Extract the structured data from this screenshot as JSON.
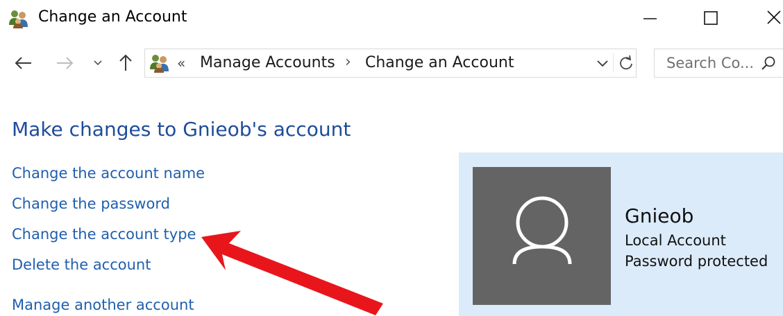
{
  "window": {
    "title": "Change an Account",
    "icon": "users-control-panel-icon",
    "controls": [
      "minimize-icon",
      "maximize-icon",
      "close-icon"
    ]
  },
  "navigation": {
    "back": "back-arrow-icon",
    "forward": "forward-arrow-icon",
    "recent": "chevron-down-icon",
    "up": "up-arrow-icon"
  },
  "address_bar": {
    "overflow": "«",
    "breadcrumbs": [
      "Manage Accounts",
      "Change an Account"
    ],
    "separator": "›"
  },
  "search": {
    "placeholder": "Search Co..."
  },
  "content": {
    "heading": "Make changes to Gnieob's account",
    "links": [
      "Change the account name",
      "Change the password",
      "Change the account type",
      "Delete the account",
      "Manage another account"
    ]
  },
  "user": {
    "name": "Gnieob",
    "type": "Local Account",
    "status": "Password protected"
  },
  "colors": {
    "heading": "#1e4c9a",
    "link": "#1f5fae",
    "panel": "#dcebfa",
    "avatar": "#646464",
    "annotation_arrow": "#e8161b"
  }
}
